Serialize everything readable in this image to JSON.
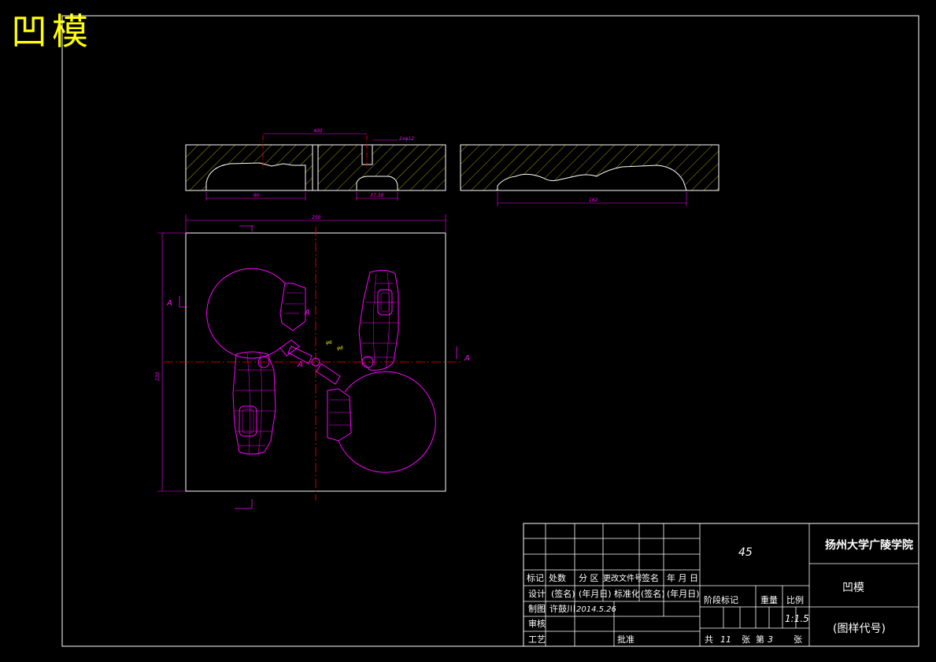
{
  "title": "凹模",
  "dimensions": {
    "top_overall": "400",
    "top_hole": "2xφ12",
    "top_cavity_left": "90",
    "top_cavity_mid": "37.38",
    "right_section": "162",
    "plan_width": "250",
    "plan_height": "230",
    "hole_dia_1": "φ6",
    "hole_dia_2": "φ8"
  },
  "section_markers": {
    "a1": "A",
    "a2": "A",
    "a3": "A",
    "a4": "A"
  },
  "title_block": {
    "material": "45",
    "school": "扬州大学广陵学院",
    "part_name": "凹模",
    "drawing_code": "(图样代号)",
    "rev_headers": [
      "标记",
      "处数",
      "分 区",
      "更改文件号",
      "签名",
      "年 月 日"
    ],
    "design_label": "设计",
    "design_sign": "(签名)",
    "design_date": "(年月日)",
    "std_label": "标准化",
    "std_sign": "(签名)",
    "std_date": "(年月日)",
    "draw_label": "制图",
    "draw_name": "许鼓川",
    "draw_date": "2014.5.26",
    "check_label": "审核",
    "process_label": "工艺",
    "approve_label": "批准",
    "stage_label": "阶段标记",
    "weight_label": "重量",
    "scale_label": "比例",
    "scale_value": "1:1.5",
    "total_label": "共",
    "total_value": "11",
    "sheets_label": "张",
    "no_label": "第",
    "no_value": "3",
    "sheet_label": "张"
  },
  "colors": {
    "frame": "#ffffff",
    "outline": "#ffffff",
    "geometry": "#ff00ff",
    "center": "#ff0000",
    "hatch": "#c8c800",
    "title": "#ffff00"
  }
}
